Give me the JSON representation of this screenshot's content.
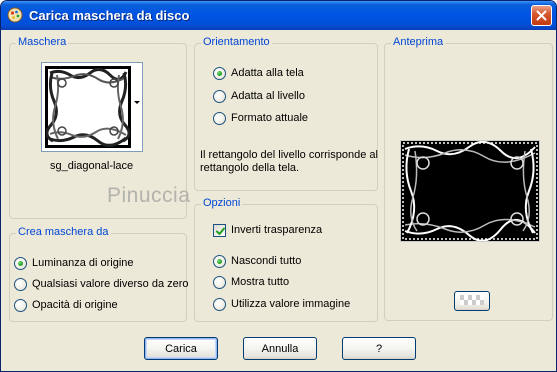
{
  "window": {
    "title": "Carica maschera da disco"
  },
  "groups": {
    "maschera": {
      "label": "Maschera",
      "mask_name": "sg_diagonal-lace"
    },
    "orientamento": {
      "label": "Orientamento",
      "options": [
        {
          "label": "Adatta alla tela",
          "selected": true
        },
        {
          "label": "Adatta al livello",
          "selected": false
        },
        {
          "label": "Formato attuale",
          "selected": false
        }
      ],
      "description": "Il rettangolo del livello corrisponde al\nrettangolo della tela."
    },
    "anteprima": {
      "label": "Anteprima"
    },
    "crea": {
      "label": "Crea maschera da",
      "options": [
        {
          "label": "Luminanza di origine",
          "selected": true
        },
        {
          "label": "Qualsiasi valore diverso da zero",
          "selected": false
        },
        {
          "label": "Opacità di origine",
          "selected": false
        }
      ]
    },
    "opzioni": {
      "label": "Opzioni",
      "checkbox": {
        "label": "Inverti trasparenza",
        "checked": true
      },
      "options": [
        {
          "label": "Nascondi tutto",
          "selected": true
        },
        {
          "label": "Mostra tutto",
          "selected": false
        },
        {
          "label": "Utilizza valore immagine",
          "selected": false
        }
      ]
    }
  },
  "buttons": {
    "carica": "Carica",
    "annulla": "Annulla",
    "help": "?"
  },
  "watermark": "Pinuccia",
  "colors": {
    "title_bar": "#0054e3",
    "group_label": "#0046d5",
    "dialog_bg": "#ece9d8",
    "radio_selected": "#21a121"
  }
}
